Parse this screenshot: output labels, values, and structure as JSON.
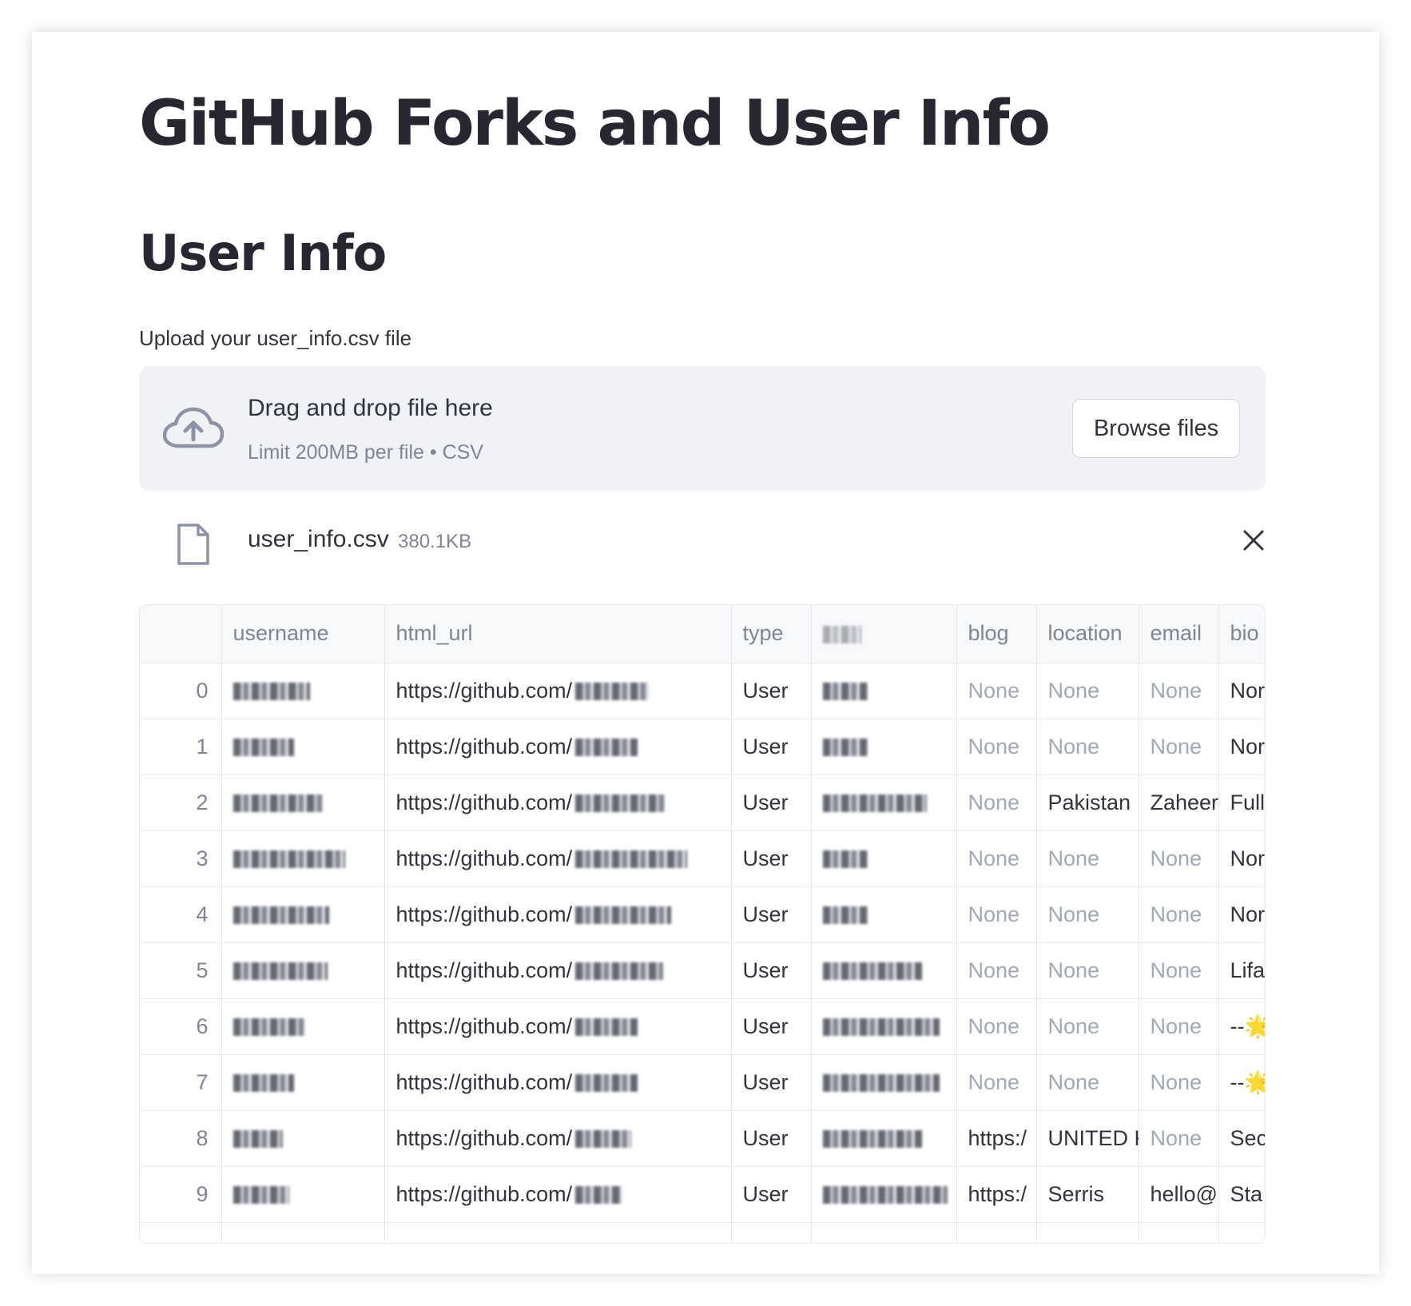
{
  "page": {
    "title": "GitHub Forks and User Info",
    "subtitle": "User Info"
  },
  "uploader": {
    "label": "Upload your user_info.csv file",
    "drop_text": "Drag and drop file here",
    "limit_text": "Limit 200MB per file • CSV",
    "browse_label": "Browse files",
    "icon": "cloud-upload-icon"
  },
  "uploaded_file": {
    "name": "user_info.csv",
    "size": "380.1KB",
    "icon": "file-icon",
    "remove_icon": "close-icon"
  },
  "table": {
    "columns": [
      "",
      "username",
      "html_url",
      "type",
      "",
      "blog",
      "location",
      "email",
      "bio"
    ],
    "rows": [
      {
        "index": "0",
        "html_url": "https://github.com/",
        "type": "User",
        "blog": "None",
        "location": "None",
        "email": "None",
        "bio": "Nor"
      },
      {
        "index": "1",
        "html_url": "https://github.com/",
        "type": "User",
        "blog": "None",
        "location": "None",
        "email": "None",
        "bio": "Nor"
      },
      {
        "index": "2",
        "html_url": "https://github.com/",
        "type": "User",
        "blog": "None",
        "location": "Pakistan",
        "email": "Zaheer",
        "bio": "Full"
      },
      {
        "index": "3",
        "html_url": "https://github.com/",
        "type": "User",
        "blog": "None",
        "location": "None",
        "email": "None",
        "bio": "Nor"
      },
      {
        "index": "4",
        "html_url": "https://github.com/",
        "type": "User",
        "blog": "None",
        "location": "None",
        "email": "None",
        "bio": "Nor"
      },
      {
        "index": "5",
        "html_url": "https://github.com/",
        "type": "User",
        "blog": "None",
        "location": "None",
        "email": "None",
        "bio": "Lifa"
      },
      {
        "index": "6",
        "html_url": "https://github.com/",
        "type": "User",
        "blog": "None",
        "location": "None",
        "email": "None",
        "bio": "--🌟"
      },
      {
        "index": "7",
        "html_url": "https://github.com/",
        "type": "User",
        "blog": "None",
        "location": "None",
        "email": "None",
        "bio": "--🌟"
      },
      {
        "index": "8",
        "html_url": "https://github.com/",
        "type": "User",
        "blog": "https:/",
        "location": "UNITED K",
        "email": "None",
        "bio": "Sec"
      },
      {
        "index": "9",
        "html_url": "https://github.com/",
        "type": "User",
        "blog": "https:/",
        "location": "Serris",
        "email": "hello@",
        "bio": "Sta"
      }
    ]
  }
}
